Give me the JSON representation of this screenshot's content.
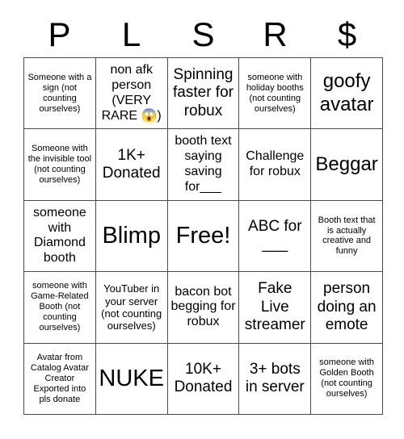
{
  "card": {
    "title_letters": [
      "P",
      "L",
      "S",
      "R",
      "$"
    ],
    "columns": 5,
    "rows": 5,
    "border_color": "#4a4a4a",
    "text_color": "#000000",
    "background_color": "#ffffff",
    "cells": [
      {
        "text": "Someone with a sign (not counting ourselves)",
        "size": "fs-xs"
      },
      {
        "text": "non afk person (VERY RARE 😱)",
        "size": "fs-m"
      },
      {
        "text": "Spinning faster for robux",
        "size": "fs-l"
      },
      {
        "text": "someone with holiday booths (not counting ourselves)",
        "size": "fs-xs"
      },
      {
        "text": "goofy avatar",
        "size": "fs-xl"
      },
      {
        "text": "Someone with the invisible tool (not counting ourselves)",
        "size": "fs-xs"
      },
      {
        "text": "1K+ Donated",
        "size": "fs-l"
      },
      {
        "text": "booth text saying saving for___",
        "size": "fs-m"
      },
      {
        "text": "Challenge for robux",
        "size": "fs-m"
      },
      {
        "text": "Beggar",
        "size": "fs-xl"
      },
      {
        "text": "someone with Diamond booth",
        "size": "fs-m"
      },
      {
        "text": "Blimp",
        "size": "fs-xxl"
      },
      {
        "text": "Free!",
        "size": "fs-xxl"
      },
      {
        "text": "ABC for ___",
        "size": "fs-l"
      },
      {
        "text": "Booth text that is actually creative and funny",
        "size": "fs-xs"
      },
      {
        "text": "someone with Game-Related Booth (not counting ourselves)",
        "size": "fs-xs"
      },
      {
        "text": "YouTuber in your server (not counting ourselves)",
        "size": "fs-s"
      },
      {
        "text": "bacon bot begging for robux",
        "size": "fs-m"
      },
      {
        "text": "Fake Live streamer",
        "size": "fs-l"
      },
      {
        "text": "person doing an emote",
        "size": "fs-l"
      },
      {
        "text": "Avatar from Catalog Avatar Creator Exported into pls donate",
        "size": "fs-xs"
      },
      {
        "text": "NUKE",
        "size": "fs-xxl"
      },
      {
        "text": "10K+ Donated",
        "size": "fs-l"
      },
      {
        "text": "3+ bots in server",
        "size": "fs-l"
      },
      {
        "text": "someone with Golden Booth (not counting ourselves)",
        "size": "fs-xs"
      }
    ]
  }
}
